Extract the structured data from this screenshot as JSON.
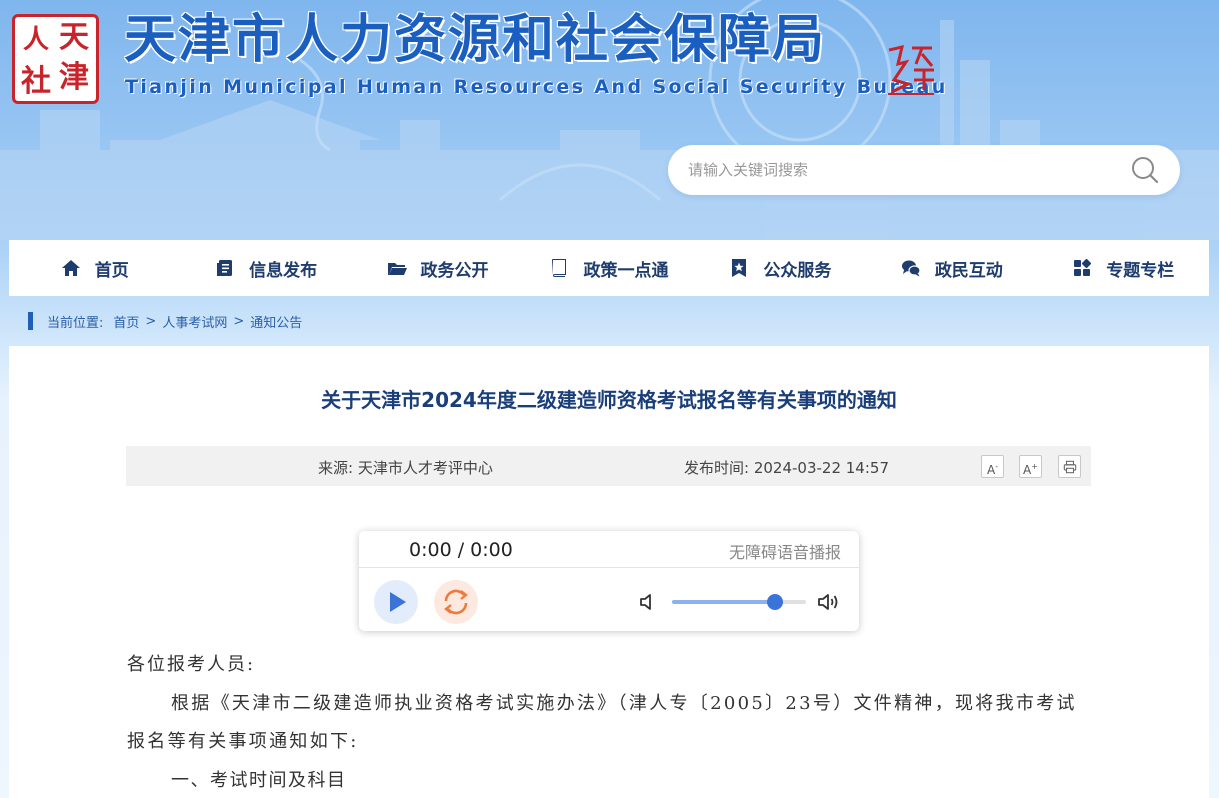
{
  "header": {
    "logo_chars": [
      "人",
      "天",
      "社",
      "津"
    ],
    "title": "天津市人力资源和社会保障局",
    "subtitle": "Tianjin Municipal Human Resources And Social Security Bureau",
    "seal_icon": "tianjin-government-seal-icon",
    "search_placeholder": "请输入关键词搜索"
  },
  "nav": {
    "items": [
      {
        "label": "首页",
        "icon": "home-icon"
      },
      {
        "label": "信息发布",
        "icon": "document-icon"
      },
      {
        "label": "政务公开",
        "icon": "folder-icon"
      },
      {
        "label": "政策一点通",
        "icon": "book-icon"
      },
      {
        "label": "公众服务",
        "icon": "star-badge-icon"
      },
      {
        "label": "政民互动",
        "icon": "chat-icon"
      },
      {
        "label": "专题专栏",
        "icon": "grid-icon"
      }
    ]
  },
  "breadcrumb": {
    "label": "当前位置:",
    "items": [
      "首页",
      "人事考试网",
      "通知公告"
    ],
    "separator": ">"
  },
  "article": {
    "title": "关于天津市2024年度二级建造师资格考试报名等有关事项的通知",
    "source": "来源:  天津市人才考评中心",
    "date": "发布时间:  2024-03-22 14:57",
    "font_smaller": "A",
    "font_larger": "A",
    "print_icon": "print-icon",
    "greeting": "各位报考人员:",
    "paragraph": "根据《天津市二级建造师执业资格考试实施办法》（津人专〔2005〕23号）文件精神，现将我市考试报名等有关事项通知如下:",
    "section1": "一、考试时间及科目"
  },
  "player": {
    "time": "0:00 / 0:00",
    "label": "无障碍语音播报",
    "volume": 0.77
  },
  "colors": {
    "primary": "#1a5fbf",
    "nav_text": "#1f3c6e",
    "seal_red": "#c8242b",
    "play_blue": "#3b74d9",
    "loop_orange": "#ee7a3c"
  }
}
